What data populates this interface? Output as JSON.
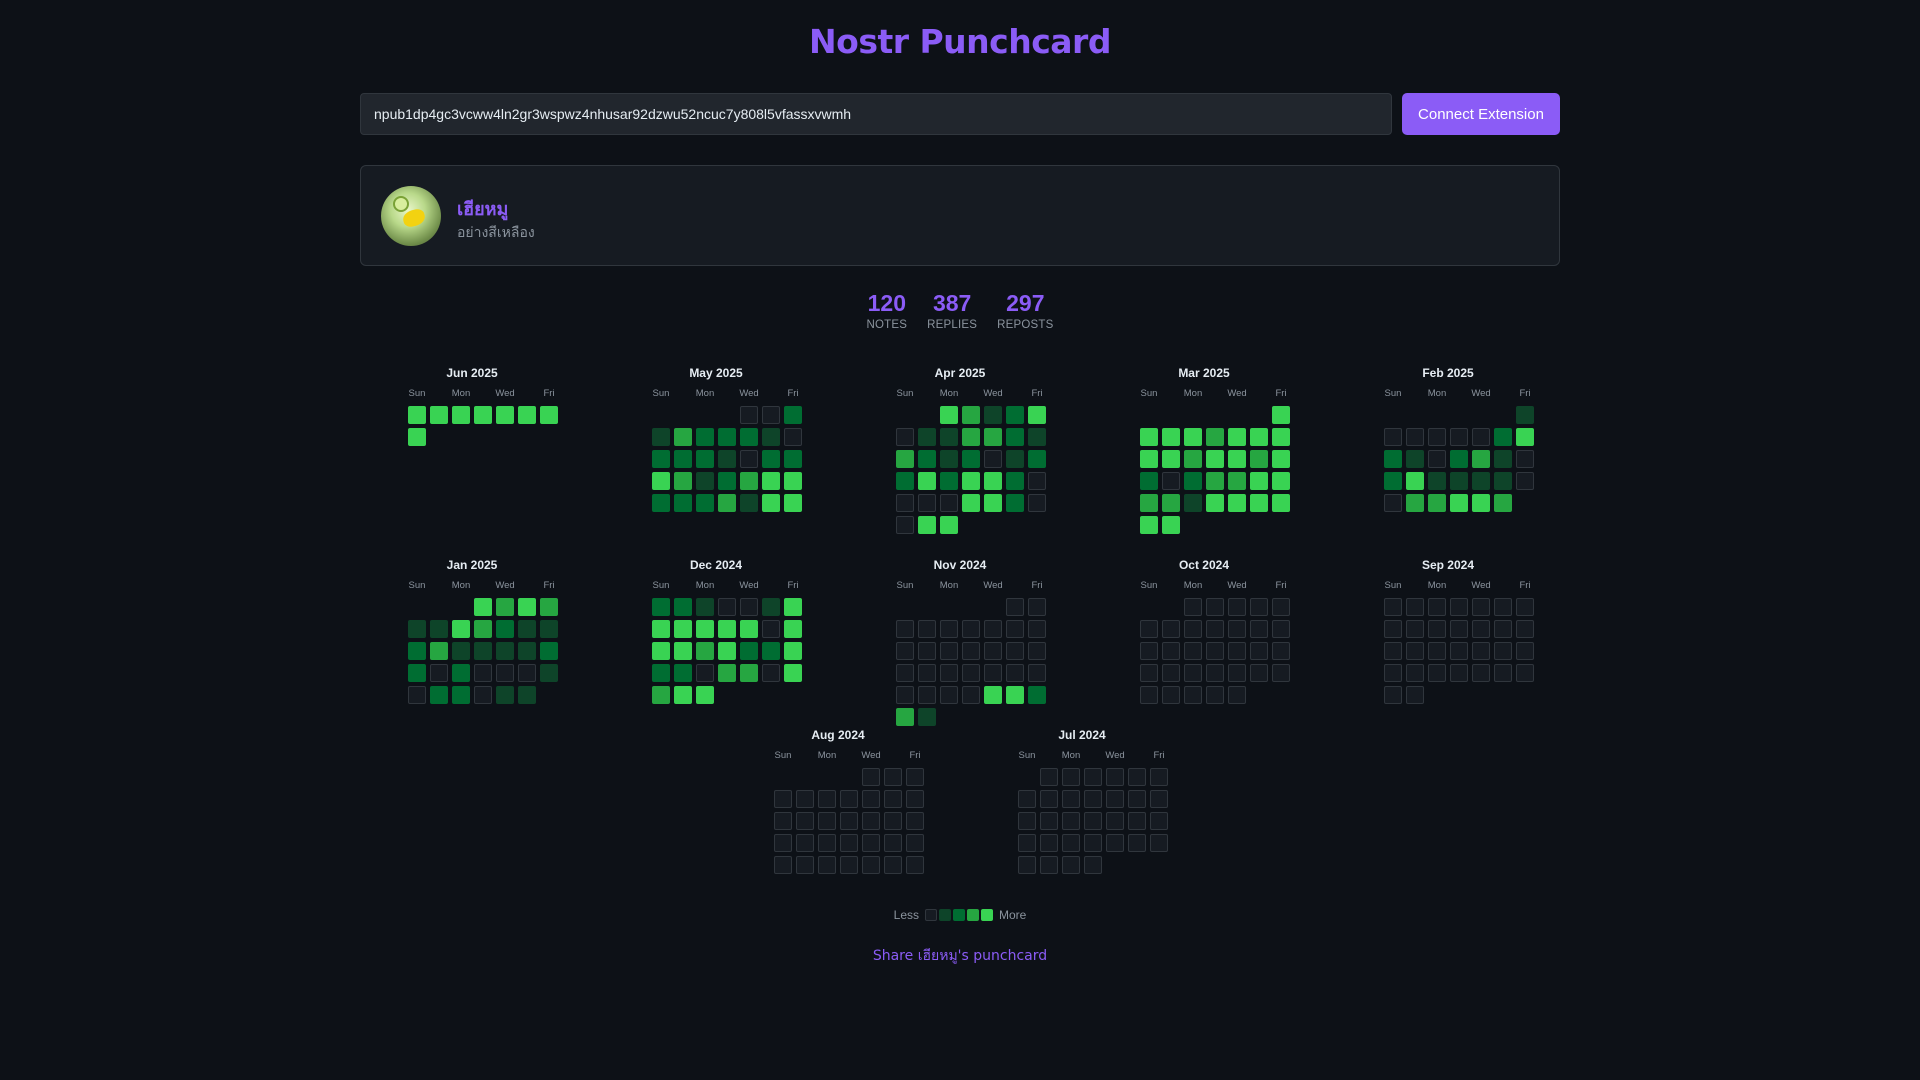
{
  "app": {
    "title": "Nostr Punchcard"
  },
  "search": {
    "value": "npub1dp4gc3vcww4ln2gr3wspwz4nhusar92dzwu52ncuc7y808l5vfassxvwmh"
  },
  "connect_button": {
    "label": "Connect Extension"
  },
  "profile": {
    "name": "เฮียหมู",
    "bio": "อย่างสีเหลือง"
  },
  "stats": [
    {
      "value": "120",
      "label": "NOTES"
    },
    {
      "value": "387",
      "label": "REPLIES"
    },
    {
      "value": "297",
      "label": "REPOSTS"
    }
  ],
  "weekday_labels": [
    "Sun",
    "Mon",
    "Wed",
    "Fri"
  ],
  "months": [
    {
      "title": "Jun 2025",
      "start": 0,
      "levels": [
        4,
        4,
        4,
        4,
        4,
        4,
        4,
        4
      ]
    },
    {
      "title": "May 2025",
      "start": 4,
      "levels": [
        0,
        0,
        2,
        1,
        3,
        2,
        2,
        2,
        1,
        0,
        2,
        2,
        2,
        1,
        0,
        2,
        2,
        4,
        3,
        1,
        2,
        3,
        4,
        4,
        2,
        2,
        2,
        3,
        1,
        4,
        4
      ]
    },
    {
      "title": "Apr 2025",
      "start": 2,
      "levels": [
        4,
        3,
        1,
        2,
        4,
        0,
        1,
        1,
        3,
        3,
        2,
        1,
        3,
        2,
        1,
        2,
        0,
        1,
        2,
        2,
        4,
        2,
        4,
        4,
        2,
        0,
        0,
        0,
        0,
        4,
        4,
        2,
        0,
        0,
        4,
        4
      ]
    },
    {
      "title": "Mar 2025",
      "start": 6,
      "levels": [
        4,
        4,
        4,
        4,
        3,
        4,
        4,
        4,
        4,
        4,
        3,
        4,
        4,
        3,
        4,
        2,
        0,
        2,
        3,
        3,
        4,
        4,
        3,
        3,
        1,
        4,
        4,
        4,
        4,
        4,
        4
      ]
    },
    {
      "title": "Feb 2025",
      "start": 6,
      "levels": [
        1,
        0,
        0,
        0,
        0,
        0,
        2,
        4,
        2,
        1,
        0,
        2,
        3,
        1,
        0,
        2,
        4,
        1,
        1,
        1,
        1,
        0,
        0,
        3,
        3,
        4,
        4,
        3
      ]
    },
    {
      "title": "Jan 2025",
      "start": 3,
      "levels": [
        4,
        3,
        4,
        3,
        1,
        1,
        4,
        3,
        2,
        1,
        1,
        2,
        3,
        1,
        1,
        1,
        1,
        2,
        2,
        0,
        2,
        0,
        0,
        0,
        1,
        0,
        2,
        2,
        0,
        1,
        1
      ]
    },
    {
      "title": "Dec 2024",
      "start": 0,
      "levels": [
        2,
        2,
        1,
        0,
        0,
        1,
        4,
        4,
        4,
        4,
        4,
        4,
        0,
        4,
        4,
        4,
        3,
        4,
        2,
        2,
        4,
        2,
        2,
        0,
        3,
        3,
        0,
        4,
        3,
        4,
        4
      ]
    },
    {
      "title": "Nov 2024",
      "start": 5,
      "levels": [
        0,
        0,
        0,
        0,
        0,
        0,
        0,
        0,
        0,
        0,
        0,
        0,
        0,
        0,
        0,
        0,
        0,
        0,
        0,
        0,
        0,
        0,
        0,
        0,
        0,
        0,
        0,
        4,
        4,
        2,
        3,
        1
      ]
    },
    {
      "title": "Oct 2024",
      "start": 2,
      "levels": [
        0,
        0,
        0,
        0,
        0,
        0,
        0,
        0,
        0,
        0,
        0,
        0,
        0,
        0,
        0,
        0,
        0,
        0,
        0,
        0,
        0,
        0,
        0,
        0,
        0,
        0,
        0,
        0,
        0,
        0,
        0
      ]
    },
    {
      "title": "Sep 2024",
      "start": 0,
      "levels": [
        0,
        0,
        0,
        0,
        0,
        0,
        0,
        0,
        0,
        0,
        0,
        0,
        0,
        0,
        0,
        0,
        0,
        0,
        0,
        0,
        0,
        0,
        0,
        0,
        0,
        0,
        0,
        0,
        0,
        0
      ]
    },
    {
      "title": "Aug 2024",
      "start": 4,
      "levels": [
        0,
        0,
        0,
        0,
        0,
        0,
        0,
        0,
        0,
        0,
        0,
        0,
        0,
        0,
        0,
        0,
        0,
        0,
        0,
        0,
        0,
        0,
        0,
        0,
        0,
        0,
        0,
        0,
        0,
        0,
        0
      ]
    },
    {
      "title": "Jul 2024",
      "start": 1,
      "levels": [
        0,
        0,
        0,
        0,
        0,
        0,
        0,
        0,
        0,
        0,
        0,
        0,
        0,
        0,
        0,
        0,
        0,
        0,
        0,
        0,
        0,
        0,
        0,
        0,
        0,
        0,
        0,
        0,
        0,
        0,
        0
      ]
    }
  ],
  "legend": {
    "less": "Less",
    "more": "More"
  },
  "share": {
    "label": "Share เฮียหมู's punchcard"
  },
  "colors": {
    "accent": "#8b5cf6",
    "levels": [
      "#161b22",
      "#0e4429",
      "#006d32",
      "#26a641",
      "#39d353"
    ]
  }
}
